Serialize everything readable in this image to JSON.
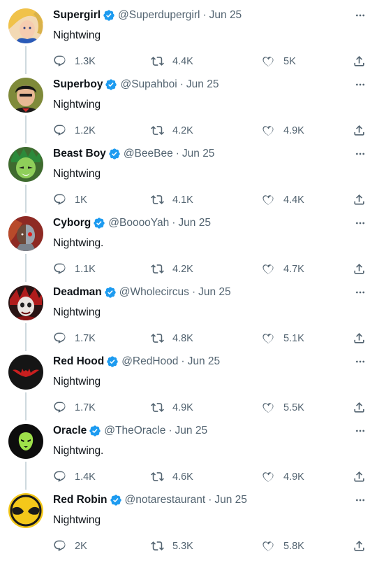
{
  "tweets": [
    {
      "name": "Supergirl",
      "handle": "@Superdupergirl",
      "date": "Jun 25",
      "text": "Nightwing",
      "replies": "1.3K",
      "retweets": "4.4K",
      "likes": "5K",
      "avatar": "supergirl-avatar"
    },
    {
      "name": "Superboy",
      "handle": "@Supahboi",
      "date": "Jun 25",
      "text": "Nightwing",
      "replies": "1.2K",
      "retweets": "4.2K",
      "likes": "4.9K",
      "avatar": "superboy-avatar"
    },
    {
      "name": "Beast Boy",
      "handle": "@BeeBee",
      "date": "Jun 25",
      "text": "Nightwing",
      "replies": "1K",
      "retweets": "4.1K",
      "likes": "4.4K",
      "avatar": "beast-boy-avatar"
    },
    {
      "name": "Cyborg",
      "handle": "@BooooYah",
      "date": "Jun 25",
      "text": "Nightwing.",
      "replies": "1.1K",
      "retweets": "4.2K",
      "likes": "4.7K",
      "avatar": "cyborg-avatar"
    },
    {
      "name": "Deadman",
      "handle": "@Wholecircus",
      "date": "Jun 25",
      "text": "Nightwing",
      "replies": "1.7K",
      "retweets": "4.8K",
      "likes": "5.1K",
      "avatar": "deadman-avatar"
    },
    {
      "name": "Red Hood",
      "handle": "@RedHood",
      "date": "Jun 25",
      "text": "Nightwing",
      "replies": "1.7K",
      "retweets": "4.9K",
      "likes": "5.5K",
      "avatar": "red-hood-avatar"
    },
    {
      "name": "Oracle",
      "handle": "@TheOracle",
      "date": "Jun 25",
      "text": "Nightwing.",
      "replies": "1.4K",
      "retweets": "4.6K",
      "likes": "4.9K",
      "avatar": "oracle-avatar"
    },
    {
      "name": "Red Robin",
      "handle": "@notarestaurant",
      "date": "Jun 25",
      "text": "Nightwing",
      "replies": "2K",
      "retweets": "5.3K",
      "likes": "5.8K",
      "avatar": "red-robin-avatar"
    }
  ],
  "separator": "·",
  "colors": {
    "verified": "#1d9bf0",
    "muted": "#536471",
    "text": "#0f1419",
    "thread_line": "#cfd9de"
  },
  "icons": {
    "reply": "reply-icon",
    "retweet": "retweet-icon",
    "like": "heart-icon",
    "share": "share-icon",
    "more": "more-icon",
    "verified": "verified-badge-icon"
  }
}
